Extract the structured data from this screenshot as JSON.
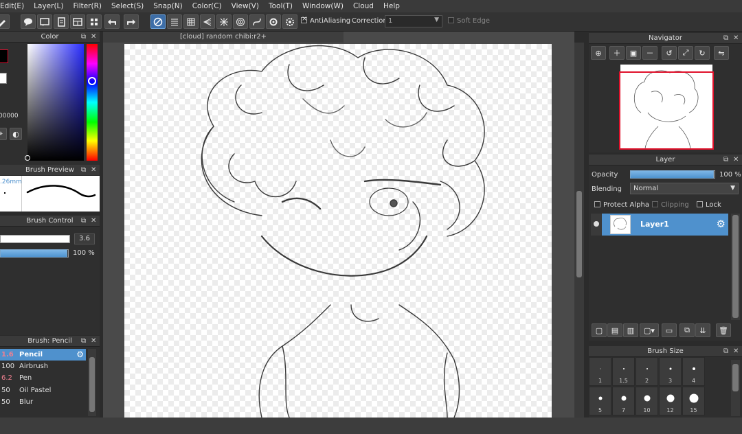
{
  "menu": [
    "Edit(E)",
    "Layer(L)",
    "Filter(R)",
    "Select(S)",
    "Snap(N)",
    "Color(C)",
    "View(V)",
    "Tool(T)",
    "Window(W)",
    "Cloud",
    "Help"
  ],
  "toolbar": {
    "antialiasing_label": "AntiAliasing",
    "correction_label": "Correction",
    "correction_value": "1",
    "soft_edge_label": "Soft Edge"
  },
  "color_panel": {
    "title": "Color",
    "hex_partial": "00000",
    "primary_color": "#000000",
    "secondary_color": "#ffffff"
  },
  "brush_preview_panel": {
    "title": "Brush Preview",
    "size_text": ".26mm"
  },
  "brush_control_panel": {
    "title": "Brush Control",
    "size_value": "3.6",
    "size_fraction": 0.99,
    "opacity_value": "100 %",
    "opacity_fraction": 1.0
  },
  "brush_list_panel": {
    "title": "Brush: Pencil",
    "items": [
      {
        "size": "1.6",
        "name": "Pencil",
        "selected": true
      },
      {
        "size": "100",
        "name": "Airbrush",
        "selected": false
      },
      {
        "size": "6.2",
        "name": "Pen",
        "selected": false
      },
      {
        "size": "50",
        "name": "Oil Pastel",
        "selected": false
      },
      {
        "size": "50",
        "name": "Blur",
        "selected": false
      }
    ]
  },
  "document": {
    "tab_title": "[cloud] random chibi:r2+"
  },
  "navigator_panel": {
    "title": "Navigator"
  },
  "layer_panel": {
    "title": "Layer",
    "opacity_label": "Opacity",
    "opacity_value": "100 %",
    "opacity_fraction": 1.0,
    "blending_label": "Blending",
    "blending_value": "Normal",
    "protect_alpha_label": "Protect Alpha",
    "clipping_label": "Clipping",
    "lock_label": "Lock",
    "layers": [
      {
        "name": "Layer1",
        "selected": true
      }
    ]
  },
  "brush_size_panel": {
    "title": "Brush Size",
    "sizes": [
      "1",
      "1.5",
      "2",
      "3",
      "4",
      "5",
      "7",
      "10",
      "12",
      "15"
    ]
  },
  "colors": {
    "accent": "#4f91cd",
    "panel_bg": "#2f2f2f",
    "header_bg": "#3a3a3a",
    "nav_frame": "#e0102a"
  }
}
